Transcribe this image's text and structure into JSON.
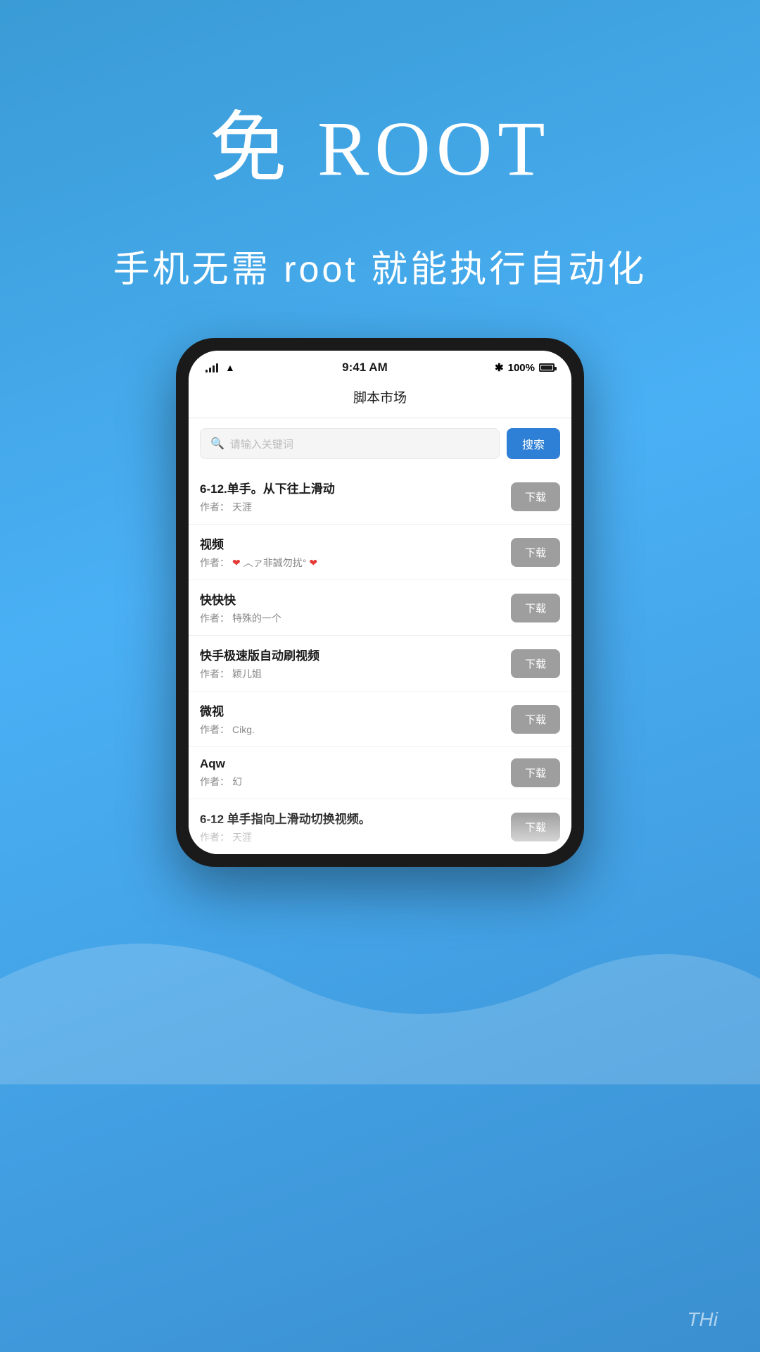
{
  "hero": {
    "title": "免 ROOT",
    "subtitle": "手机无需 root 就能执行自动化"
  },
  "phone": {
    "statusBar": {
      "time": "9:41 AM",
      "battery": "100%",
      "bluetooth": "✱"
    },
    "navTitle": "脚本市场",
    "search": {
      "placeholder": "请输入关键词",
      "buttonLabel": "搜索"
    },
    "items": [
      {
        "title": "6-12.单手。从下往上滑动",
        "author": "天涯",
        "authorPrefix": "作者：",
        "downloadLabel": "下载"
      },
      {
        "title": "视频",
        "author": "❤ ︿ァ非誠勿扰°❤",
        "authorPrefix": "作者：",
        "downloadLabel": "下载",
        "hasEmoji": true
      },
      {
        "title": "快快快",
        "author": "特殊的一个",
        "authorPrefix": "作者：",
        "downloadLabel": "下载"
      },
      {
        "title": "快手极速版自动刷视频",
        "author": "颖儿姐",
        "authorPrefix": "作者：",
        "downloadLabel": "下载"
      },
      {
        "title": "微视",
        "author": "Cikg.",
        "authorPrefix": "作者：",
        "downloadLabel": "下载"
      },
      {
        "title": "Aqw",
        "author": "幻",
        "authorPrefix": "作者：",
        "downloadLabel": "下载"
      },
      {
        "title": "6-12  单手指向上滑动切换视频。",
        "author": "天涯",
        "authorPrefix": "作者：",
        "downloadLabel": "下载",
        "partial": true
      }
    ]
  },
  "bottomLabel": "THi"
}
